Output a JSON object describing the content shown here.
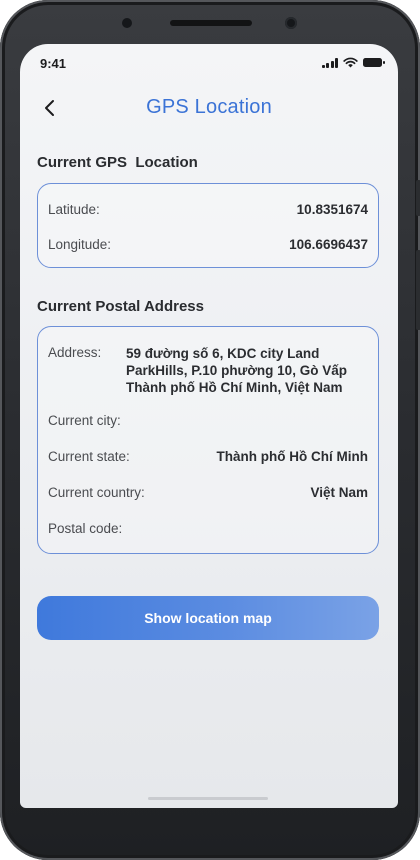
{
  "status_bar": {
    "time": "9:41"
  },
  "nav": {
    "title": "GPS Location"
  },
  "gps": {
    "title": "Current GPS  Location",
    "latitude_label": "Latitude:",
    "latitude_value": "10.8351674",
    "longitude_label": "Longitude:",
    "longitude_value": "106.6696437"
  },
  "postal": {
    "title": "Current Postal Address",
    "address_label": "Address:",
    "address_lines": [
      "59 đường số 6, KDC city Land",
      "ParkHills, P.10 phường 10, Gò Vấp",
      "Thành phố Hồ Chí  Minh, Việt Nam"
    ],
    "city_label": "Current city:",
    "city_value": "",
    "state_label": "Current state:",
    "state_value": "Thành phố Hồ Chí Minh",
    "country_label": "Current country:",
    "country_value": "Việt Nam",
    "postal_label": "Postal code:",
    "postal_value": ""
  },
  "actions": {
    "show_map": "Show location map"
  },
  "colors": {
    "accent": "#3b73d6",
    "card_border": "#6d90d8",
    "button": "#4a80dd"
  },
  "icons": [
    "back-chevron-icon",
    "signal-icon",
    "wifi-icon",
    "battery-icon"
  ]
}
